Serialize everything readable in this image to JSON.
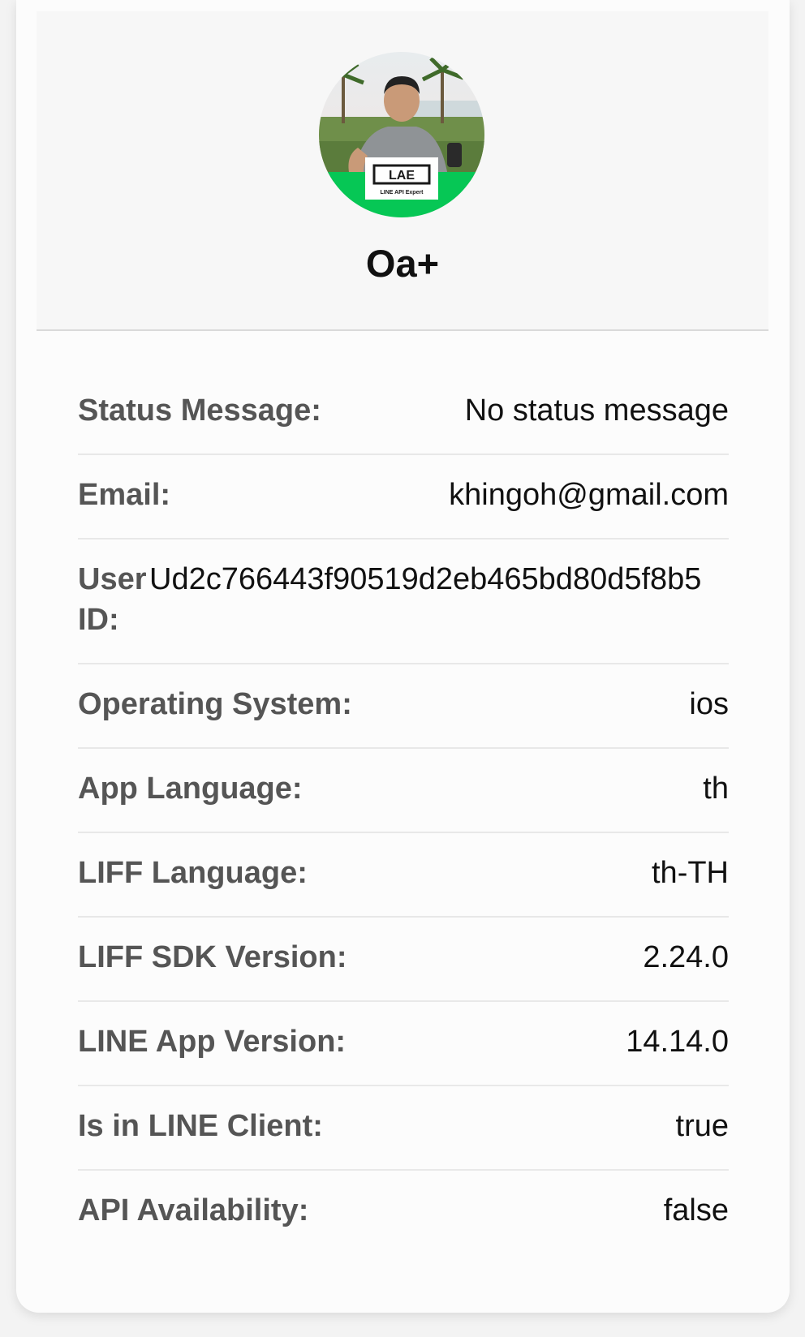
{
  "profile": {
    "display_name": "Oa+",
    "avatar_badge": "LAE",
    "avatar_badge_sub": "LINE API Expert"
  },
  "info": {
    "status_message": {
      "label": "Status Message:",
      "value": "No status message"
    },
    "email": {
      "label": "Email:",
      "value": "khingoh@gmail.com"
    },
    "user_id": {
      "label_line1": "User",
      "label_line2": "ID:",
      "value": "Ud2c766443f90519d2eb465bd80d5f8b5"
    },
    "operating_system": {
      "label": "Operating System:",
      "value": "ios"
    },
    "app_language": {
      "label": "App Language:",
      "value": "th"
    },
    "liff_language": {
      "label": "LIFF Language:",
      "value": "th-TH"
    },
    "liff_sdk_version": {
      "label": "LIFF SDK Version:",
      "value": "2.24.0"
    },
    "line_app_version": {
      "label": "LINE App Version:",
      "value": "14.14.0"
    },
    "is_in_line_client": {
      "label": "Is in LINE Client:",
      "value": "true"
    },
    "api_availability": {
      "label": "API Availability:",
      "value": "false"
    }
  },
  "colors": {
    "line_green": "#06c755",
    "label_gray": "#555555",
    "value_black": "#111111"
  }
}
